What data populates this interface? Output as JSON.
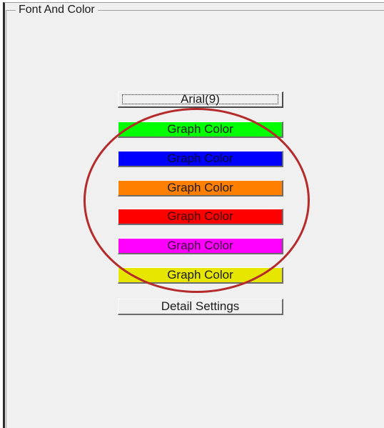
{
  "group": {
    "title": "Font And Color"
  },
  "font_button": {
    "label": "Arial(9)"
  },
  "color_buttons": [
    {
      "label": "Graph Color",
      "bg": "#00ff00",
      "fg": "#1a1a1a"
    },
    {
      "label": "Graph Color",
      "bg": "#0000ff",
      "fg": "#0a0a30"
    },
    {
      "label": "Graph Color",
      "bg": "#ff8000",
      "fg": "#1a1a1a"
    },
    {
      "label": "Graph Color",
      "bg": "#ff0000",
      "fg": "#3a0000"
    },
    {
      "label": "Graph Color",
      "bg": "#ff00ff",
      "fg": "#3a003a"
    },
    {
      "label": "Graph Color",
      "bg": "#e6e600",
      "fg": "#1a1a1a"
    }
  ],
  "detail_button": {
    "label": "Detail Settings"
  },
  "annotation": {
    "highlight_color": "#b52a2a"
  }
}
